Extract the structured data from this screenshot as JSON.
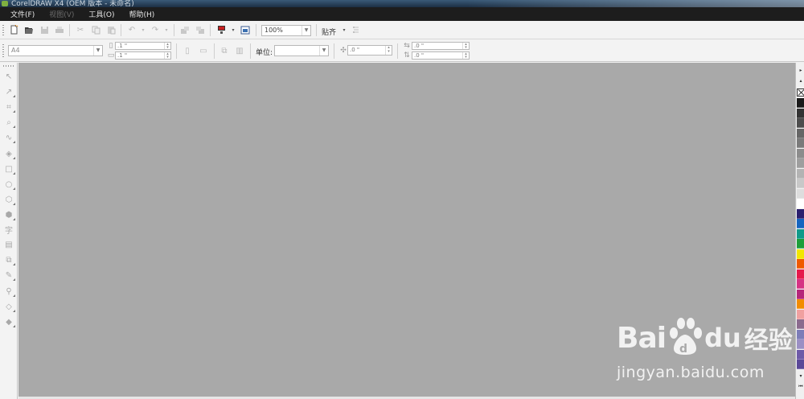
{
  "window": {
    "title": "CorelDRAW X4 (OEM 版本 - 未命名)"
  },
  "menu": [
    {
      "label": "文件(F)",
      "enabled": true
    },
    {
      "label": "视图(V)",
      "enabled": false
    },
    {
      "label": "工具(O)",
      "enabled": true
    },
    {
      "label": "帮助(H)",
      "enabled": true
    }
  ],
  "standard_toolbar": {
    "zoom_value": "100%",
    "snap_label": "贴齐",
    "icons": [
      "new-icon",
      "open-icon",
      "save-icon",
      "print-icon",
      "cut-icon",
      "copy-icon",
      "paste-icon",
      "undo-icon",
      "redo-icon",
      "import-icon",
      "export-icon",
      "application-launcher-icon",
      "welcome-screen-icon",
      "options-icon"
    ]
  },
  "property_bar": {
    "paper_size": "A4",
    "paper_width": ".1 \"",
    "paper_height": ".1 \"",
    "units_label": "单位:",
    "units_value": "",
    "nudge_value": ".0 \"",
    "duplicate_x": ".0 \"",
    "duplicate_y": ".0 \""
  },
  "toolbox": {
    "tools": [
      "pick-tool-icon",
      "shape-tool-icon",
      "crop-tool-icon",
      "zoom-tool-icon",
      "freehand-tool-icon",
      "smart-fill-tool-icon",
      "rectangle-tool-icon",
      "ellipse-tool-icon",
      "polygon-tool-icon",
      "basic-shapes-tool-icon",
      "text-tool-icon",
      "table-tool-icon",
      "interactive-blend-tool-icon",
      "eyedropper-tool-icon",
      "outline-tool-icon",
      "fill-tool-icon",
      "interactive-fill-tool-icon"
    ],
    "text_tool_glyph": "字"
  },
  "palette": {
    "colors": [
      "#1a1a1a",
      "#333333",
      "#4d4d4d",
      "#666666",
      "#7a7a7a",
      "#8c8c8c",
      "#9e9e9e",
      "#b3b3b3",
      "#c8c8c8",
      "#dddddd",
      "#ffffff",
      "#2b1f6e",
      "#1565c0",
      "#109a8a",
      "#1e9e3a",
      "#f2e600",
      "#f05a00",
      "#e6194b",
      "#d63384",
      "#b5267a",
      "#f28c00",
      "#f0a0a0",
      "#8b6b8e",
      "#7d7db8",
      "#9b8fc4",
      "#6e5aa8",
      "#5a4898"
    ]
  },
  "watermark": {
    "logo_bai": "Bai",
    "logo_du": "du",
    "logo_cn": "经验",
    "url": "jingyan.baidu.com"
  }
}
